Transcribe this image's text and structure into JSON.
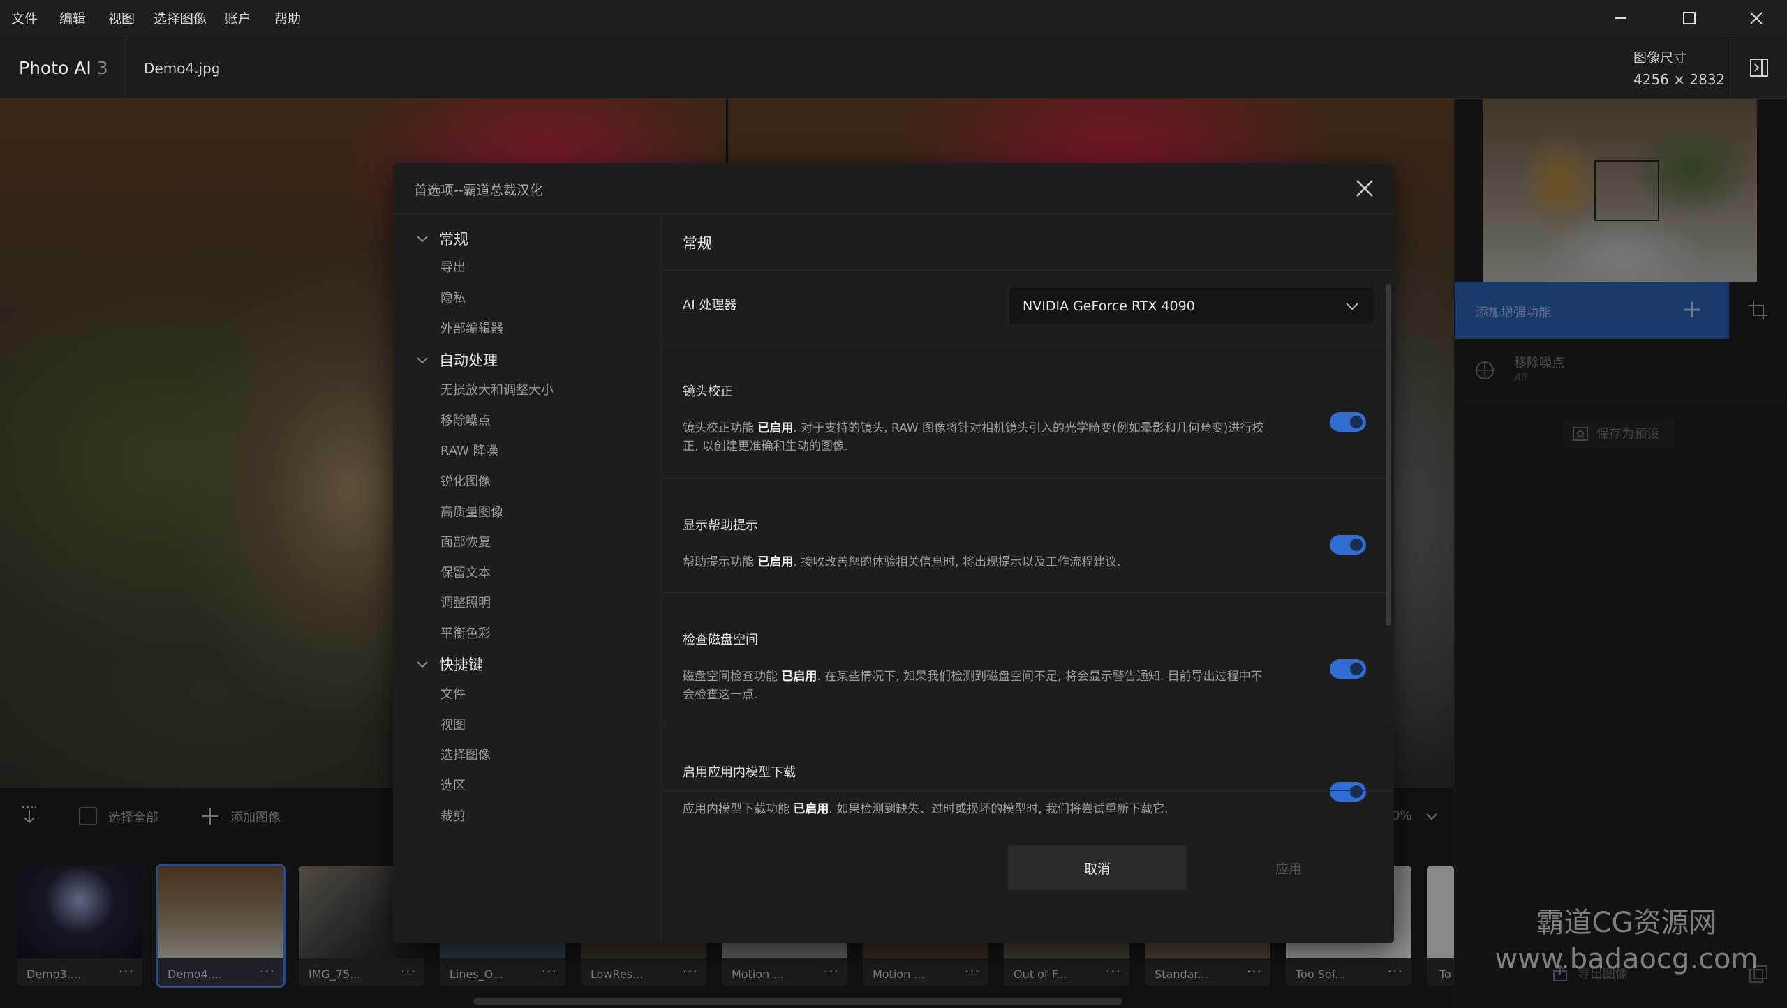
{
  "menubar": {
    "items": [
      "文件",
      "编辑",
      "视图",
      "选择图像",
      "账户",
      "帮助"
    ]
  },
  "header": {
    "app_name": "Photo AI",
    "app_version": "3",
    "file_name": "Demo4.jpg",
    "image_size_label": "图像尺寸",
    "image_size_value": "4256 × 2832"
  },
  "toolbar": {
    "select_all": "选择全部",
    "add_image": "添加图像",
    "zoom_partial": "0%"
  },
  "filmstrip": [
    {
      "name": "Demo3....",
      "selected": false
    },
    {
      "name": "Demo4....",
      "selected": true
    },
    {
      "name": "IMG_75...",
      "selected": false
    },
    {
      "name": "Lines_O...",
      "selected": false
    },
    {
      "name": "LowRes...",
      "selected": false
    },
    {
      "name": "Motion ...",
      "selected": false
    },
    {
      "name": "Motion ...",
      "selected": false
    },
    {
      "name": "Out of F...",
      "selected": false
    },
    {
      "name": "Standar...",
      "selected": false
    },
    {
      "name": "Too Sof...",
      "selected": false
    },
    {
      "name": "To",
      "selected": false
    }
  ],
  "right_panel": {
    "add_enhancement": "添加增强功能",
    "enhancement_title": "移除噪点",
    "enhancement_sub": "All",
    "save_preset": "保存为预设",
    "export": "导出图像"
  },
  "dialog": {
    "title": "首选项--霸道总裁汉化",
    "sidebar": {
      "sections": [
        {
          "label": "常规",
          "items": [
            "导出",
            "隐私",
            "外部编辑器"
          ]
        },
        {
          "label": "自动处理",
          "items": [
            "无损放大和调整大小",
            "移除噪点",
            "RAW 降噪",
            "锐化图像",
            "高质量图像",
            "面部恢复",
            "保留文本",
            "调整照明",
            "平衡色彩"
          ]
        },
        {
          "label": "快捷键",
          "items": [
            "文件",
            "视图",
            "选择图像",
            "选区",
            "裁剪"
          ]
        }
      ]
    },
    "main": {
      "title": "常规",
      "ai_processor_label": "AI 处理器",
      "ai_processor_value": "NVIDIA GeForce RTX 4090",
      "options": [
        {
          "title": "镜头校正",
          "desc_pre": "镜头校正功能",
          "status": "已启用",
          "desc_post": ". 对于支持的镜头, RAW 图像将针对相机镜头引入的光学畸变(例如晕影和几何畸变)进行校正, 以创建更准确和生动的图像.",
          "enabled": true
        },
        {
          "title": "显示帮助提示",
          "desc_pre": "帮助提示功能",
          "status": "已启用",
          "desc_post": ". 接收改善您的体验相关信息时, 将出现提示以及工作流程建议.",
          "enabled": true
        },
        {
          "title": "检查磁盘空间",
          "desc_pre": "磁盘空间检查功能",
          "status": "已启用",
          "desc_post": ". 在某些情况下, 如果我们检测到磁盘空间不足, 将会显示警告通知. 目前导出过程中不会检查这一点.",
          "enabled": true
        },
        {
          "title": "启用应用内模型下载",
          "desc_pre": "应用内模型下载功能",
          "status": "已启用",
          "desc_post": ". 如果检测到缺失、过时或损坏的模型时, 我们将尝试重新下载它.",
          "enabled": true
        }
      ]
    },
    "cancel": "取消",
    "apply": "应用"
  },
  "watermark": {
    "line1": "霸道CG资源网",
    "line2": "www.badaocg.com"
  },
  "colors": {
    "accent": "#2f6fd3",
    "enhance_bar": "#2a61b3",
    "dialog_bg": "#1d1d1d"
  }
}
